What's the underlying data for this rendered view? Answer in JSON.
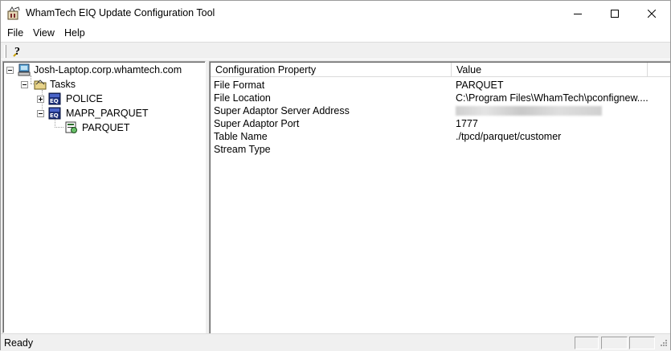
{
  "window": {
    "title": "WhamTech EIQ Update Configuration Tool"
  },
  "menu": {
    "file": "File",
    "view": "View",
    "help": "Help"
  },
  "tree": {
    "root": "Josh-Laptop.corp.whamtech.com",
    "tasks": "Tasks",
    "police": "POLICE",
    "mapr_parquet": "MAPR_PARQUET",
    "parquet": "PARQUET"
  },
  "list": {
    "headers": {
      "property": "Configuration Property",
      "value": "Value"
    },
    "rows": [
      {
        "property": "File Format",
        "value": "PARQUET"
      },
      {
        "property": "File Location",
        "value": "C:\\Program Files\\WhamTech\\pconfignew...."
      },
      {
        "property": "Super Adaptor Server Address",
        "value": ""
      },
      {
        "property": "Super Adaptor Port",
        "value": "1777"
      },
      {
        "property": "Table Name",
        "value": "./tpcd/parquet/customer"
      },
      {
        "property": "Stream Type",
        "value": ""
      }
    ]
  },
  "status": {
    "text": "Ready"
  },
  "icons": {
    "app": "eiq-app-icon",
    "help": "help-icon",
    "computer": "computer-icon",
    "tasks": "tasks-folder-icon",
    "eiq": "eiq-task-icon",
    "config": "config-icon"
  }
}
